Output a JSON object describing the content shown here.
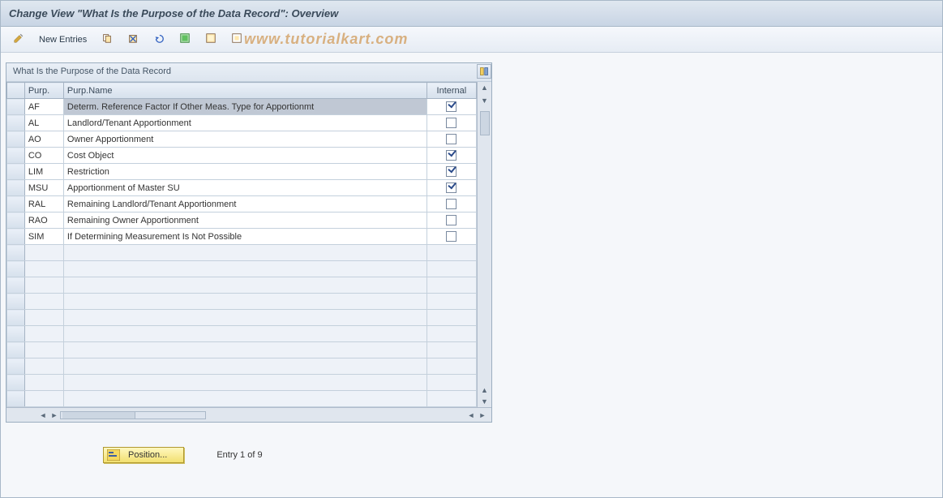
{
  "header": {
    "title": "Change View \"What Is the Purpose of the Data Record\": Overview"
  },
  "toolbar": {
    "new_entries_label": "New Entries"
  },
  "panel": {
    "title": "What Is the Purpose of the Data Record",
    "columns": {
      "purp": "Purp.",
      "purp_name": "Purp.Name",
      "internal": "Internal"
    }
  },
  "rows": [
    {
      "purp": "AF",
      "name": "Determ. Reference Factor If Other Meas. Type for Apportionmt",
      "internal": true,
      "selected": true
    },
    {
      "purp": "AL",
      "name": "Landlord/Tenant Apportionment",
      "internal": false,
      "selected": false
    },
    {
      "purp": "AO",
      "name": "Owner Apportionment",
      "internal": false,
      "selected": false
    },
    {
      "purp": "CO",
      "name": "Cost Object",
      "internal": true,
      "selected": false
    },
    {
      "purp": "LIM",
      "name": "Restriction",
      "internal": true,
      "selected": false
    },
    {
      "purp": "MSU",
      "name": "Apportionment of Master SU",
      "internal": true,
      "selected": false
    },
    {
      "purp": "RAL",
      "name": "Remaining Landlord/Tenant Apportionment",
      "internal": false,
      "selected": false
    },
    {
      "purp": "RAO",
      "name": "Remaining Owner Apportionment",
      "internal": false,
      "selected": false
    },
    {
      "purp": "SIM",
      "name": "If Determining Measurement Is Not Possible",
      "internal": false,
      "selected": false
    }
  ],
  "empty_row_count": 10,
  "footer": {
    "position_label": "Position...",
    "entry_text": "Entry 1 of 9"
  },
  "watermark": "www.tutorialkart.com"
}
